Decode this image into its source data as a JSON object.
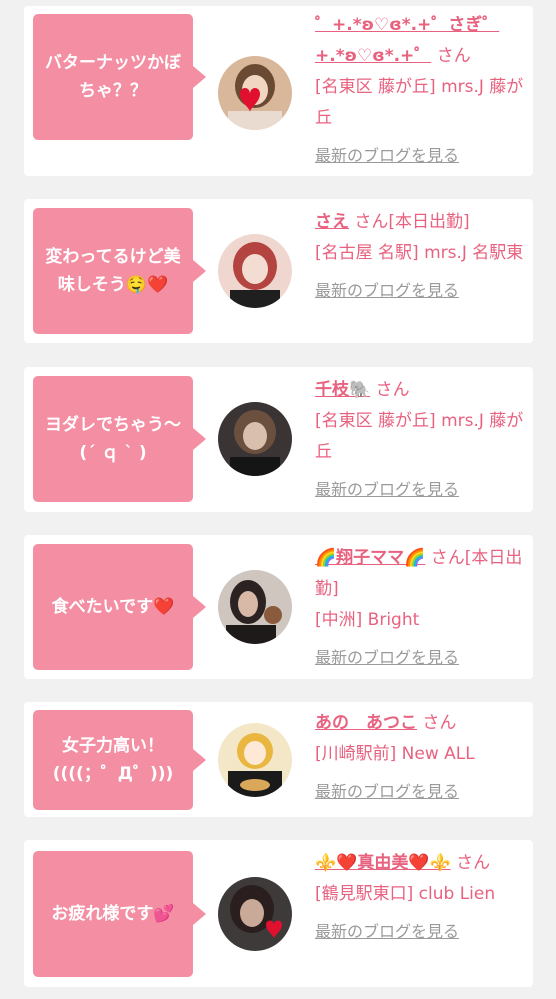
{
  "comments": [
    {
      "comment": "バターナッツかぼちゃ？？",
      "name": "゜+.*ʚ♡ɞ*.+゜さぎ゜+.*ʚ♡ɞ*.+゜",
      "suffix": "さん",
      "shop": "[名東区 藤が丘] mrs.J 藤が丘",
      "blog_link": "最新のブログを見る",
      "avatar_icon": "avatar-heart-photo"
    },
    {
      "comment": "変わってるけど美味しそう🤤❤️",
      "name": "さえ",
      "suffix": "さん[本日出勤]",
      "shop": "[名古屋 名駅] mrs.J 名駅東",
      "blog_link": "最新のブログを見る",
      "avatar_icon": "avatar-photo"
    },
    {
      "comment": "ヨダレでちゃう〜(´ ｑ ` )",
      "name": "千枝🐘",
      "suffix": "さん",
      "shop": "[名東区 藤が丘] mrs.J 藤が丘",
      "blog_link": "最新のブログを見る",
      "avatar_icon": "avatar-photo"
    },
    {
      "comment": "食べたいです❤️",
      "name": "🌈翔子ママ🌈",
      "suffix": "さん[本日出勤]",
      "shop": "[中洲] Bright",
      "blog_link": "最新のブログを見る",
      "avatar_icon": "avatar-photo"
    },
    {
      "comment": "女子力高い！((((；゜Д゜)))",
      "name": "あの　あつこ",
      "suffix": "さん",
      "shop": "[川崎駅前] New ALL",
      "blog_link": "最新のブログを見る",
      "avatar_icon": "avatar-photo"
    },
    {
      "comment": "お疲れ様です💕",
      "name": "⚜️❤️真由美❤️⚜️",
      "suffix": "さん",
      "shop": "[鶴見駅東口] club Lien",
      "blog_link": "最新のブログを見る",
      "avatar_icon": "avatar-heart-photo"
    }
  ],
  "colors": {
    "accent": "#f38ea3",
    "link": "#e8627f",
    "muted": "#9a9a9a",
    "background": "#f1f1f1"
  }
}
